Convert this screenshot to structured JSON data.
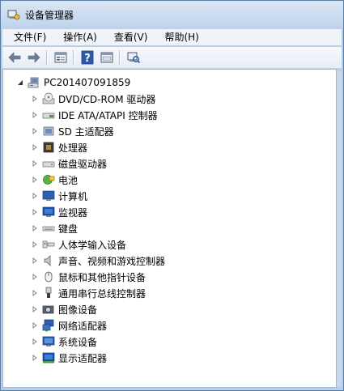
{
  "window": {
    "title": "设备管理器"
  },
  "menu": [
    {
      "label": "文件(F)"
    },
    {
      "label": "操作(A)"
    },
    {
      "label": "查看(V)"
    },
    {
      "label": "帮助(H)"
    }
  ],
  "toolbar": {
    "buttons": [
      "back-arrow-icon",
      "forward-arrow-icon",
      "properties-icon",
      "help-icon",
      "show-hide-pane-icon",
      "scan-hardware-icon"
    ]
  },
  "tree": {
    "root": {
      "label": "PC201407091859",
      "icon": "computer-icon",
      "expanded": true
    },
    "items": [
      {
        "label": "DVD/CD-ROM 驱动器",
        "icon": "dvd-drive-icon"
      },
      {
        "label": "IDE ATA/ATAPI 控制器",
        "icon": "ide-controller-icon"
      },
      {
        "label": "SD 主适配器",
        "icon": "sd-adapter-icon"
      },
      {
        "label": "处理器",
        "icon": "processor-icon"
      },
      {
        "label": "磁盘驱动器",
        "icon": "disk-drive-icon"
      },
      {
        "label": "电池",
        "icon": "battery-icon"
      },
      {
        "label": "计算机",
        "icon": "computer-monitor-icon"
      },
      {
        "label": "监视器",
        "icon": "monitor-icon"
      },
      {
        "label": "键盘",
        "icon": "keyboard-icon"
      },
      {
        "label": "人体学输入设备",
        "icon": "hid-icon"
      },
      {
        "label": "声音、视频和游戏控制器",
        "icon": "speaker-icon"
      },
      {
        "label": "鼠标和其他指针设备",
        "icon": "mouse-icon"
      },
      {
        "label": "通用串行总线控制器",
        "icon": "usb-icon"
      },
      {
        "label": "图像设备",
        "icon": "camera-icon"
      },
      {
        "label": "网络适配器",
        "icon": "network-adapter-icon"
      },
      {
        "label": "系统设备",
        "icon": "system-device-icon"
      },
      {
        "label": "显示适配器",
        "icon": "display-adapter-icon"
      }
    ]
  }
}
